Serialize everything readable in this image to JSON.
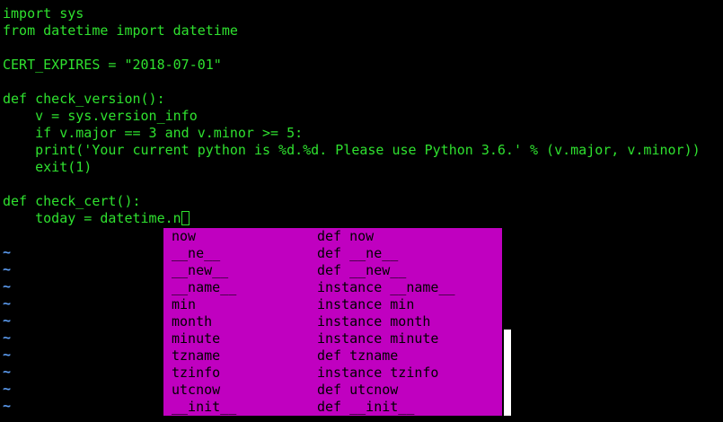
{
  "editor": {
    "lines": [
      "import sys",
      "from datetime import datetime",
      "",
      "CERT_EXPIRES = \"2018-07-01\"",
      "",
      "def check_version():",
      "    v = sys.version_info",
      "    if v.major == 3 and v.minor >= 5:",
      "    print('Your current python is %d.%d. Please use Python 3.6.' % (v.major, v.minor))",
      "    exit(1)",
      "",
      "def check_cert():",
      "    today = datetime.n"
    ],
    "empty_line_marker": "~",
    "empty_line_count": 10
  },
  "completion": {
    "items": [
      {
        "word": "now",
        "menu": "def now"
      },
      {
        "word": "__ne__",
        "menu": "def __ne__"
      },
      {
        "word": "__new__",
        "menu": "def __new__"
      },
      {
        "word": "__name__",
        "menu": "instance __name__"
      },
      {
        "word": "min",
        "menu": "instance min"
      },
      {
        "word": "month",
        "menu": "instance month"
      },
      {
        "word": "minute",
        "menu": "instance minute"
      },
      {
        "word": "tzname",
        "menu": "def tzname"
      },
      {
        "word": "tzinfo",
        "menu": "instance tzinfo"
      },
      {
        "word": "utcnow",
        "menu": "def utcnow"
      },
      {
        "word": "__init__",
        "menu": "def __init__"
      }
    ]
  },
  "colors": {
    "background": "#000000",
    "code_text": "#2fe12f",
    "tilde": "#5b9bf0",
    "popup_bg": "#c000c0",
    "popup_text": "#000000",
    "scrollbar_thumb": "#ffffff"
  }
}
